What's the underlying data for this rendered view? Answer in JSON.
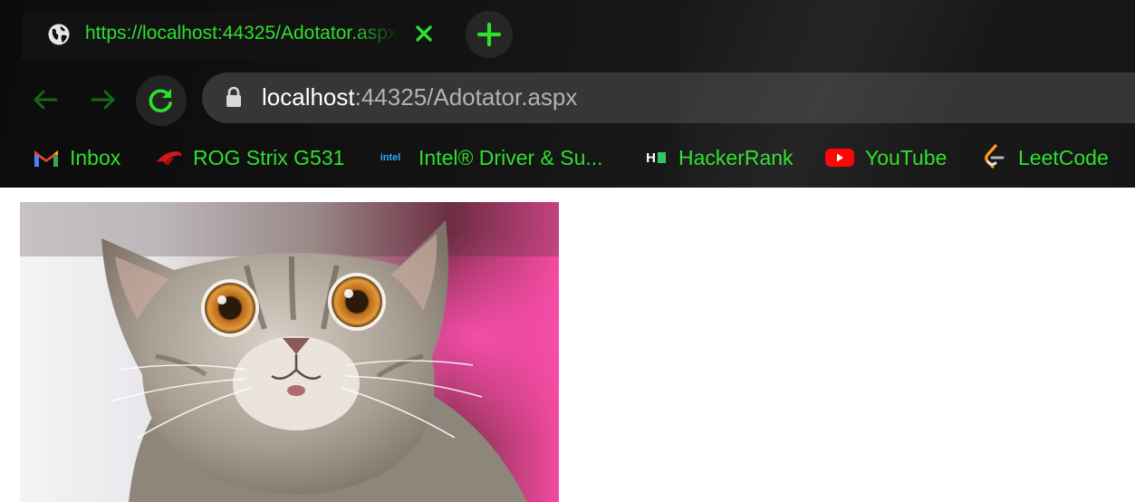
{
  "tab": {
    "title": "https://localhost:44325/Adotator.aspx",
    "favicon_icon": "globe-icon",
    "close_icon": "close-icon"
  },
  "new_tab_icon": "plus-icon",
  "toolbar": {
    "back_icon": "back-arrow-icon",
    "forward_icon": "forward-arrow-icon",
    "reload_icon": "reload-icon",
    "lock_icon": "lock-icon"
  },
  "address_bar": {
    "host": "localhost",
    "rest": ":44325/Adotator.aspx"
  },
  "bookmarks": [
    {
      "label": "Inbox",
      "icon": "gmail-icon"
    },
    {
      "label": "ROG Strix G531",
      "icon": "rog-icon"
    },
    {
      "label": "Intel® Driver & Su...",
      "icon": "intel-icon",
      "icon_text": "intel"
    },
    {
      "label": "HackerRank",
      "icon": "hackerrank-icon",
      "icon_text": "H"
    },
    {
      "label": "YouTube",
      "icon": "youtube-icon"
    },
    {
      "label": "LeetCode",
      "icon": "leetcode-icon"
    }
  ],
  "content": {
    "image": "surprised-cat-photo"
  },
  "colors": {
    "accent_green": "#2de02d",
    "chrome_bg": "#121212",
    "omnibox_bg": "#363636"
  }
}
